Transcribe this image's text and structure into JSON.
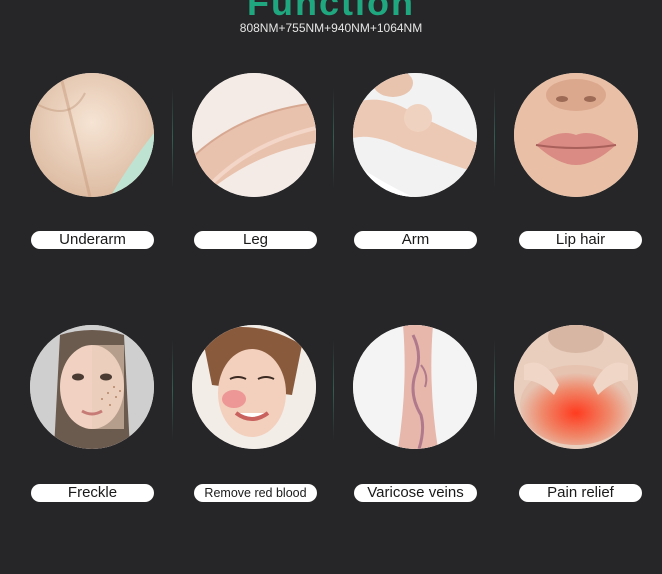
{
  "header": {
    "title": "Function",
    "subtitle": "808NM+755NM+940NM+1064NM"
  },
  "items": [
    {
      "label": "Underarm",
      "icon": "underarm-photo"
    },
    {
      "label": "Leg",
      "icon": "leg-photo"
    },
    {
      "label": "Arm",
      "icon": "arm-photo"
    },
    {
      "label": "Lip hair",
      "icon": "lip-photo"
    },
    {
      "label": "Freckle",
      "icon": "freckle-face-photo"
    },
    {
      "label": "Remove red blood",
      "icon": "red-cheek-face-photo"
    },
    {
      "label": "Varicose veins",
      "icon": "varicose-leg-photo"
    },
    {
      "label": "Pain relief",
      "icon": "neck-pain-photo"
    }
  ],
  "colors": {
    "background": "#262628",
    "accent": "#1fa880",
    "label_bg": "#ffffff"
  }
}
